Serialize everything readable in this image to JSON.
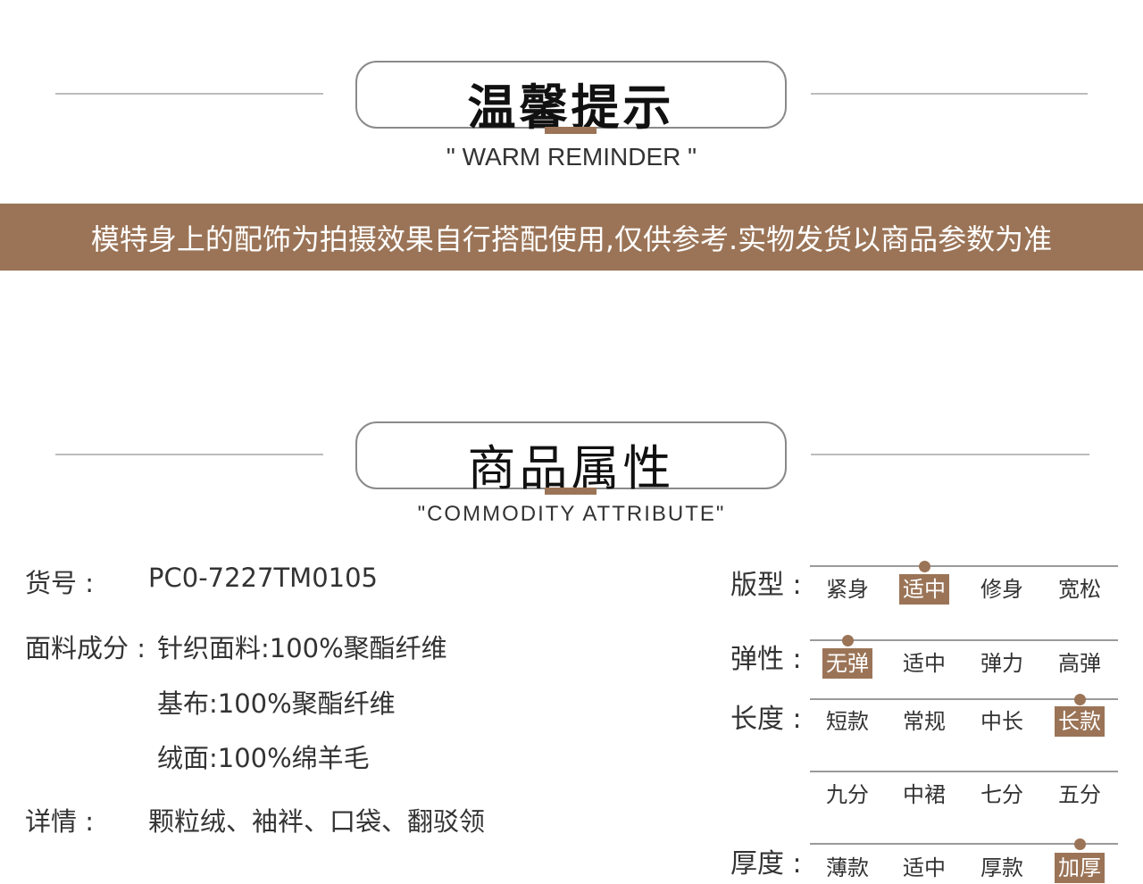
{
  "colors": {
    "accent": "#9b7457",
    "line": "#bcbcbc"
  },
  "reminder": {
    "title": "温馨提示",
    "subtitle": "\" WARM REMINDER \"",
    "notice": "模特身上的配饰为拍摄效果自行搭配使用,仅供参考.实物发货以商品参数为准"
  },
  "attributes_header": {
    "title": "商品属性",
    "subtitle": "\"COMMODITY ATTRIBUTE\""
  },
  "attributes": {
    "sku_label": "货号 :",
    "sku_value": "PC0-7227TM0105",
    "fabric_label": "面料成分 :",
    "fabric_lines": [
      "针织面料:100%聚酯纤维",
      "基布:100%聚酯纤维",
      "绒面:100%绵羊毛"
    ],
    "details_label": "详情 :",
    "details_value": "颗粒绒、袖袢、口袋、翻驳领"
  },
  "selectors": [
    {
      "label": "版型 :",
      "options": [
        "紧身",
        "适中",
        "修身",
        "宽松"
      ],
      "selected": 1
    },
    {
      "label": "弹性 :",
      "options": [
        "无弹",
        "适中",
        "弹力",
        "高弹"
      ],
      "selected": 0
    },
    {
      "label": "长度 :",
      "options": [
        "短款",
        "常规",
        "中长",
        "长款"
      ],
      "selected": 3,
      "extra_options": [
        "九分",
        "中裙",
        "七分",
        "五分"
      ]
    },
    {
      "label": "厚度 :",
      "options": [
        "薄款",
        "适中",
        "厚款",
        "加厚"
      ],
      "selected": 3
    }
  ]
}
